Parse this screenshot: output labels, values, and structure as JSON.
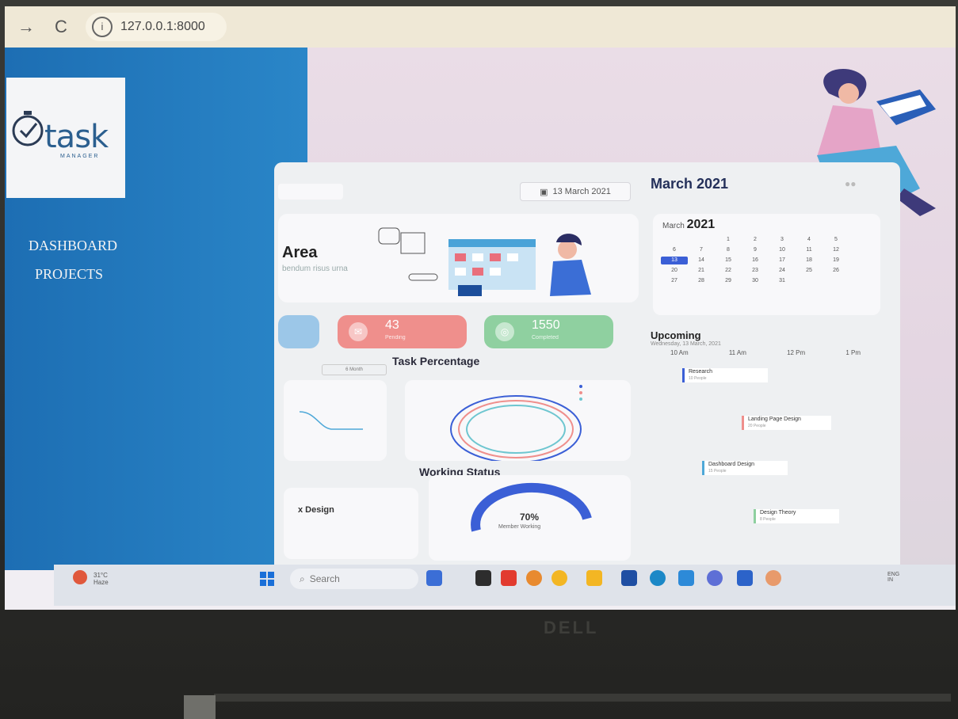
{
  "browser": {
    "back": "→",
    "reload": "C",
    "info": "ⓘ",
    "url": "127.0.0.1:8000"
  },
  "sidebar": {
    "logo_text": "task",
    "logo_sub": "MANAGER",
    "items": [
      {
        "label": "DASHBOARD"
      },
      {
        "label": "PROJECTS"
      }
    ]
  },
  "dashboard": {
    "date_chip": "13 March 2021",
    "month_title": "March 2021",
    "hero_title": "Area",
    "hero_sub": "bendum risus urna",
    "stats": [
      {
        "value": "",
        "label": ""
      },
      {
        "value": "43",
        "label": "Pending"
      },
      {
        "value": "1550",
        "label": "Completed"
      }
    ],
    "task_percentage_title": "Task Percentage",
    "working_status_title": "Working Status",
    "month_chip": "6 Month",
    "design_title": "x Design",
    "working_value": "70%",
    "working_label": "Member Working",
    "calendar": {
      "month": "March",
      "year": "2021",
      "days": [
        "",
        "",
        "1",
        "2",
        "3",
        "4",
        "5",
        "6",
        "7",
        "8",
        "9",
        "10",
        "11",
        "12",
        "13",
        "14",
        "15",
        "16",
        "17",
        "18",
        "19",
        "20",
        "21",
        "22",
        "23",
        "24",
        "25",
        "26",
        "27",
        "28",
        "29",
        "30",
        "31"
      ],
      "today": "13"
    },
    "upcoming_title": "Upcoming",
    "upcoming_sub": "Wednesday, 13 March, 2021",
    "times": [
      "10 Am",
      "11 Am",
      "12 Pm",
      "1 Pm"
    ],
    "events": [
      {
        "title": "Research",
        "sub": "10 People"
      },
      {
        "title": "Landing Page Design",
        "sub": "20 People"
      },
      {
        "title": "Dashboard Design",
        "sub": "15 People"
      },
      {
        "title": "Design Theory",
        "sub": "8 People"
      }
    ]
  },
  "taskbar": {
    "weather_temp": "31°C",
    "weather_desc": "Haze",
    "search": "Search",
    "tray_lang": "ENG",
    "tray_region": "IN"
  },
  "laptop_brand": "DELL",
  "colors": {
    "sidebar": "#1d6eb3",
    "stat_red": "#ef8f8c",
    "stat_green": "#8fd0a0",
    "stat_blue": "#9cc7e8",
    "accent": "#3b5fd6"
  }
}
